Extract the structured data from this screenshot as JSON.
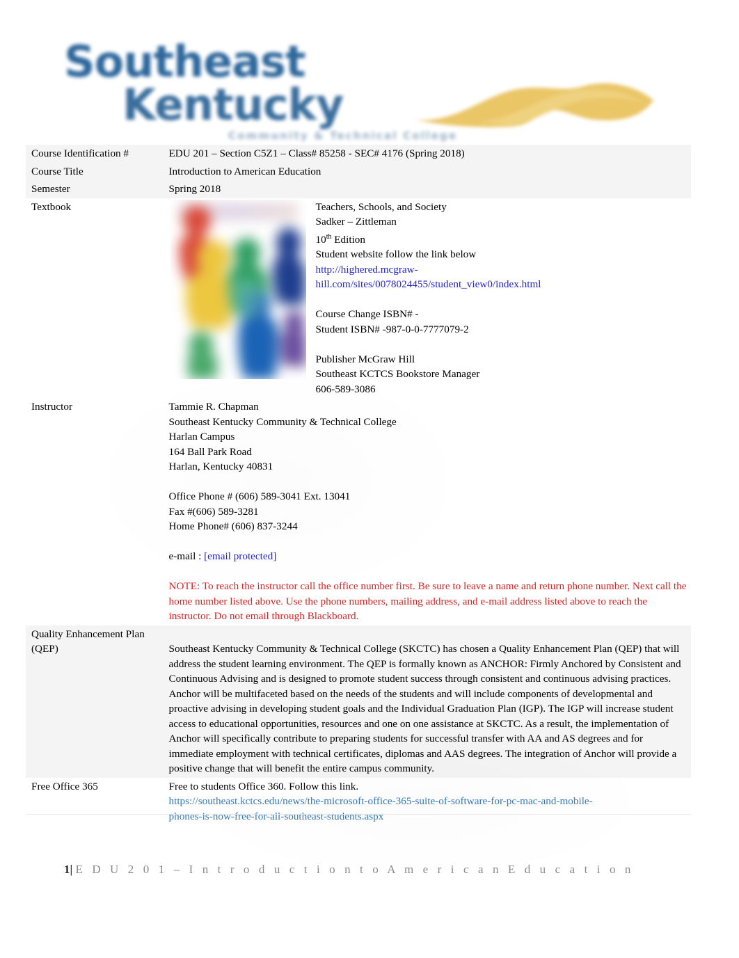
{
  "logo": {
    "word1": "Southeast",
    "word2": "Kentucky",
    "subtitle": "Community & Technical College",
    "brand_blue": "#1d5c94",
    "brand_gold": "#e8c15a",
    "swoosh_icon": "gold-swoosh-icon"
  },
  "table": {
    "rows": [
      {
        "label": "Course Identification #",
        "value": "EDU 201 –  Section C5Z1 – Class# 85258 -   SEC# 4176  (Spring 2018)"
      },
      {
        "label": "Course Title",
        "value": "Introduction to American Education"
      },
      {
        "label": "Semester",
        "value": "Spring 2018"
      },
      {
        "label": "Textbook",
        "value": ""
      },
      {
        "label": "Instructor",
        "value": ""
      },
      {
        "label": "Quality Enhancement Plan (QEP)",
        "value": ""
      },
      {
        "label": "Free Office 365",
        "value": ""
      }
    ]
  },
  "textbook": {
    "cover_alt": "textbook-cover-image",
    "title": "Teachers, Schools, and Society",
    "authors": "Sadker – Zittleman",
    "edition_number": "10",
    "edition_suffix": "th",
    "edition_word": " Edition",
    "website_note": "Student website follow the link below",
    "website_url_line1": "http://highered.mcgraw-",
    "website_url_line2": "hill.com/sites/0078024455/student_view0/index.html",
    "course_change_isbn": "Course Change ISBN# -",
    "student_isbn": "Student ISBN# -987-0-0-7777079-2",
    "publisher": "Publisher McGraw Hill",
    "bookstore": "Southeast KCTCS Bookstore Manager",
    "bookstore_phone": "606-589-3086"
  },
  "instructor": {
    "name": "Tammie R. Chapman",
    "college": "Southeast Kentucky Community & Technical College",
    "campus": "Harlan Campus",
    "street": "164 Ball Park Road",
    "city_state_zip": "Harlan, Kentucky 40831",
    "office_phone": "Office Phone # (606) 589-3041 Ext. 13041",
    "fax": "Fax #(606) 589-3281",
    "home_phone": "Home Phone#  (606) 837-3244",
    "email_label": "e-mail : ",
    "email_value": "[email protected]",
    "note": "NOTE: To reach the instructor call the office number first.    Be sure to leave a name and return phone number.   Next call the home number listed above.     Use the phone numbers, mailing address, and e-mail address listed above to reach the instructor. Do not      email through Blackboard.",
    "note_color": "#e02020"
  },
  "qep": {
    "paragraph": "Southeast Kentucky Community & Technical College (SKCTC) has chosen a Quality Enhancement Plan (QEP)  that will address the student learning environment. The QEP is formally known as ANCHOR: Firmly Anchored by Consistent and Continuous Advising and is designed to promote student success through consistent and continuous advising practices. Anchor will be multifaceted based on the needs of the students and will include components of developmental and proactive advising in developing student goals and the Individual Graduation Plan (IGP).  The IGP will increase student access to educational opportunities, resources and one on one assistance at SKCTC.  As a result, the implementation of Anchor will specifically contribute to preparing students for successful transfer with AA and AS degrees and for immediate employment with technical certificates, diplomas and AAS degrees.   The integration of Anchor will provide a positive change that will benefit the entire campus community."
  },
  "office365": {
    "intro": "Free to students Office 360.   Follow this link.",
    "url_line1": "https://southeast.kctcs.edu/news/the-microsoft-office-365-suite-of-software-for-pc-mac-and-mobile-",
    "url_line2": "phones-is-now-free-for-all-southeast-students.aspx",
    "link_color": "#3679bd"
  },
  "footer": {
    "page_number": "1",
    "separator": "| ",
    "text": "E D U  2 0 1  –  I n t r o d u c t i o n  t o  A m e r i c a n  E d u c a t i o n"
  }
}
